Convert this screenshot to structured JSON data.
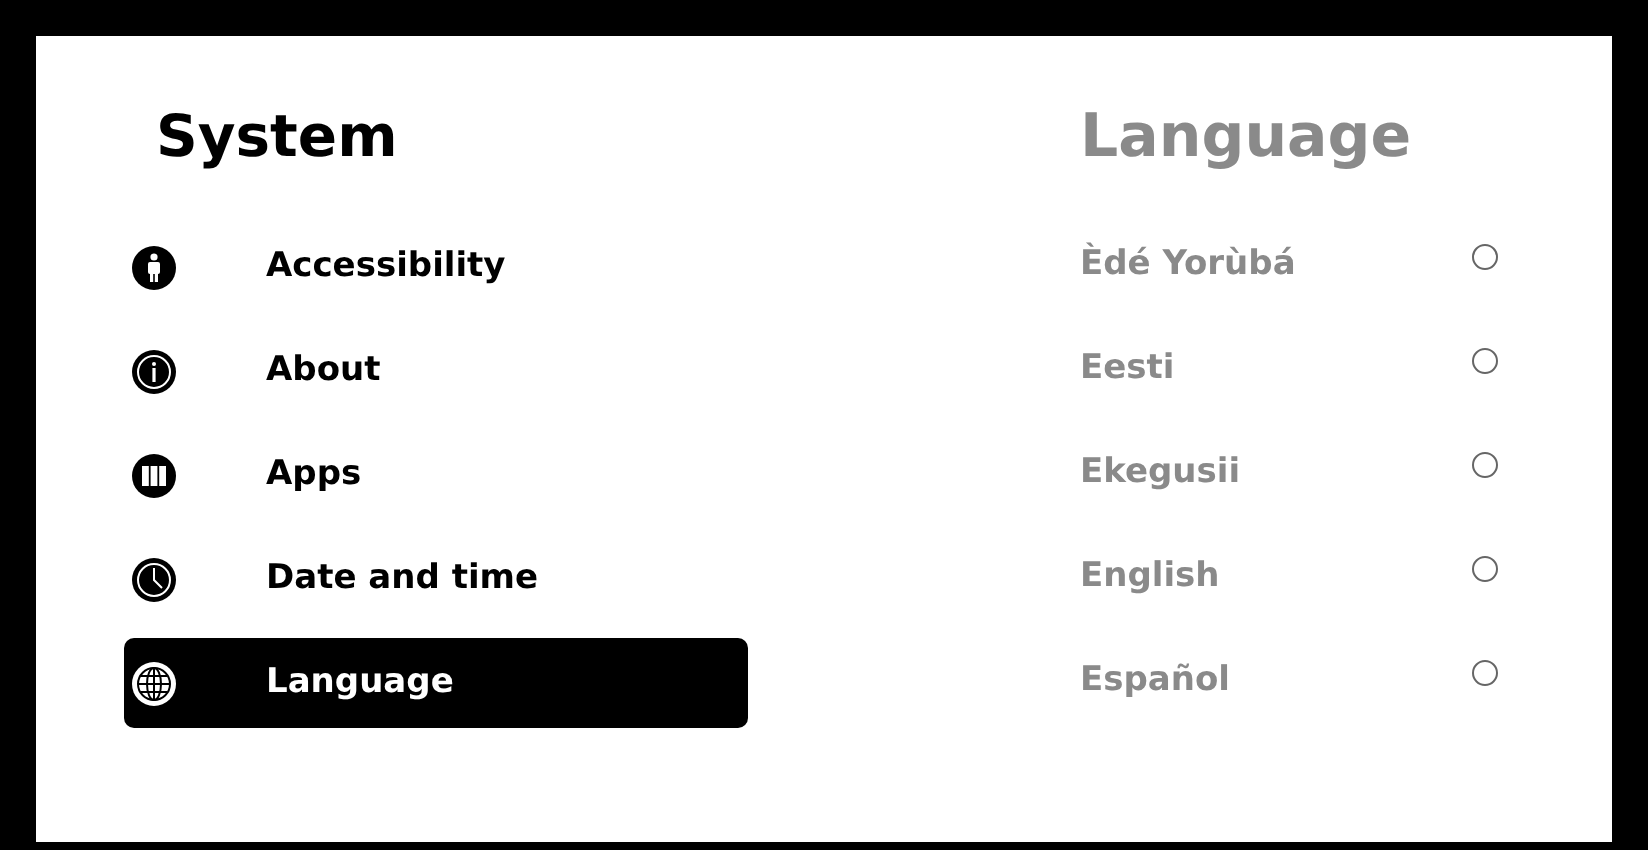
{
  "sidebar": {
    "title": "System",
    "items": [
      {
        "label": "Accessibility",
        "selected": false
      },
      {
        "label": "About",
        "selected": false
      },
      {
        "label": "Apps",
        "selected": false
      },
      {
        "label": "Date and time",
        "selected": false
      },
      {
        "label": "Language",
        "selected": true
      }
    ]
  },
  "panel": {
    "title": "Language",
    "options": [
      {
        "label": "Èdé Yorùbá",
        "selected": false
      },
      {
        "label": "Eesti",
        "selected": false
      },
      {
        "label": "Ekegusii",
        "selected": false
      },
      {
        "label": "English",
        "selected": false
      },
      {
        "label": "Español",
        "selected": false
      }
    ]
  }
}
